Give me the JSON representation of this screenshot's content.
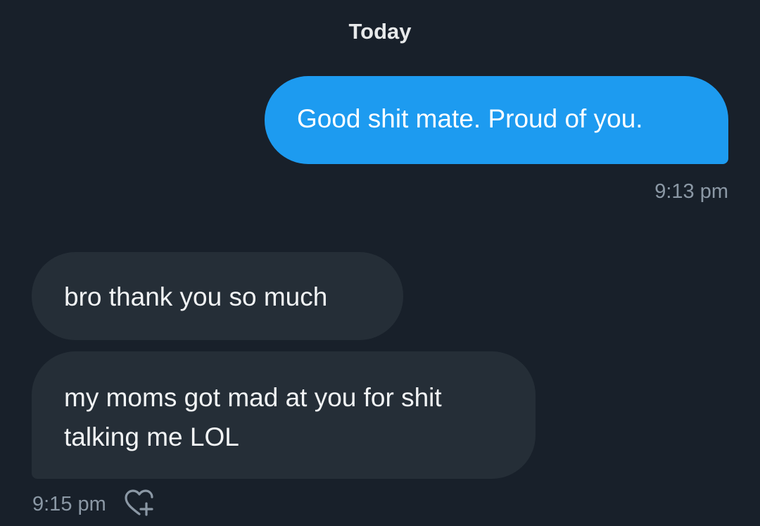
{
  "conversation": {
    "date_divider": "Today",
    "messages": [
      {
        "direction": "outgoing",
        "text": "Good shit mate. Proud of you.",
        "time": "9:13 pm"
      },
      {
        "direction": "incoming",
        "text": "bro thank you so much"
      },
      {
        "direction": "incoming",
        "text": "my moms got mad at you for shit talking me LOL",
        "time": "9:15 pm"
      }
    ],
    "colors": {
      "background": "#18202a",
      "outgoing_bubble": "#1d9bf0",
      "incoming_bubble": "#252e37",
      "timestamp": "#8b98a5"
    },
    "icons": {
      "reaction": "heart-plus-icon"
    }
  }
}
